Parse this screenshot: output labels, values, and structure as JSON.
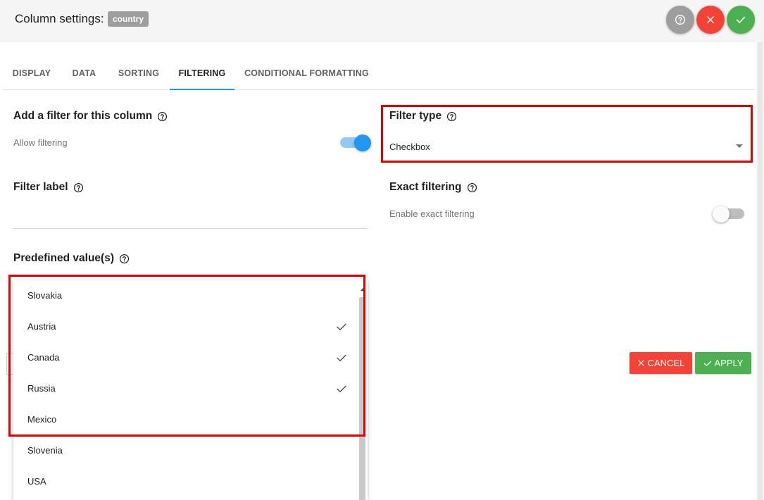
{
  "header": {
    "title": "Column settings:",
    "column_badge": "country",
    "help_icon": "help-circle-icon",
    "close_icon": "close-icon",
    "confirm_icon": "check-icon",
    "colors": {
      "help": "#9e9e9e",
      "close": "#f44336",
      "confirm": "#4caf50"
    }
  },
  "tabs": [
    {
      "label": "DISPLAY"
    },
    {
      "label": "DATA"
    },
    {
      "label": "SORTING"
    },
    {
      "label": "FILTERING",
      "active": true
    },
    {
      "label": "CONDITIONAL FORMATTING"
    }
  ],
  "add_filter": {
    "title": "Add a filter for this column",
    "toggle_label": "Allow filtering",
    "enabled": true
  },
  "filter_type": {
    "title": "Filter type",
    "value": "Checkbox"
  },
  "filter_label": {
    "title": "Filter label",
    "value": ""
  },
  "exact_filtering": {
    "title": "Exact filtering",
    "toggle_label": "Enable exact filtering",
    "enabled": false
  },
  "predefined": {
    "title": "Predefined value(s)",
    "options": [
      {
        "label": "Slovakia",
        "selected": false
      },
      {
        "label": "Austria",
        "selected": true
      },
      {
        "label": "Canada",
        "selected": true
      },
      {
        "label": "Russia",
        "selected": true
      },
      {
        "label": "Mexico",
        "selected": false
      },
      {
        "label": "Slovenia",
        "selected": false
      },
      {
        "label": "USA",
        "selected": false
      }
    ]
  },
  "actions": {
    "cancel": "CANCEL",
    "apply": "APPLY"
  },
  "accent_color": "#2196f3",
  "highlight_color": "#e00000"
}
